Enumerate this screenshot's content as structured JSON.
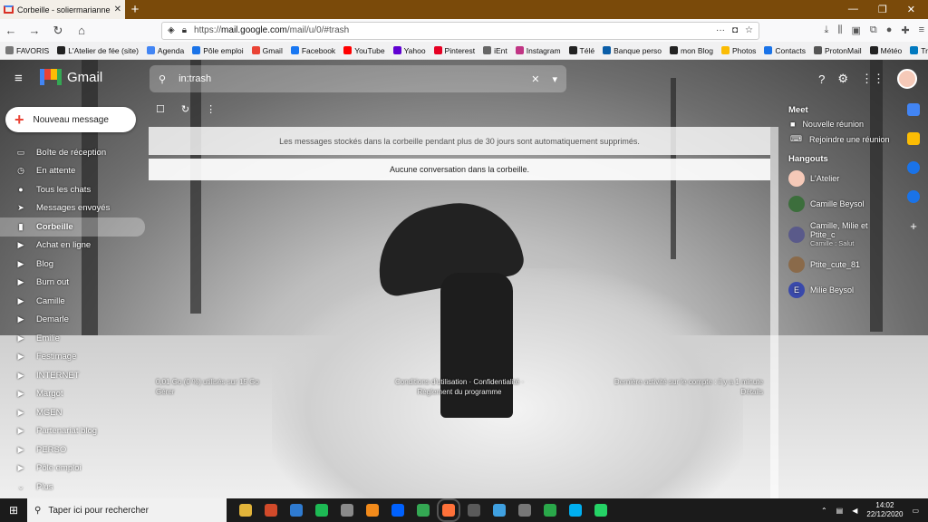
{
  "browser": {
    "tab_title": "Corbeille - soliermarianne@gm",
    "url_prefix": "https://",
    "url_domain": "mail.google.com",
    "url_path": "/mail/u/0/#trash"
  },
  "bookmarks": [
    {
      "label": "FAVORIS",
      "color": "#777"
    },
    {
      "label": "L'Atelier de fée (site)",
      "color": "#222"
    },
    {
      "label": "Agenda",
      "color": "#4285f4"
    },
    {
      "label": "Pôle emploi",
      "color": "#1a73e8"
    },
    {
      "label": "Gmail",
      "color": "#ea4335"
    },
    {
      "label": "Facebook",
      "color": "#1877f2"
    },
    {
      "label": "YouTube",
      "color": "#ff0000"
    },
    {
      "label": "Yahoo",
      "color": "#6001d2"
    },
    {
      "label": "Pinterest",
      "color": "#e60023"
    },
    {
      "label": "iEnt",
      "color": "#666"
    },
    {
      "label": "Instagram",
      "color": "#c13584"
    },
    {
      "label": "Télé",
      "color": "#222"
    },
    {
      "label": "Banque perso",
      "color": "#0b5ea8"
    },
    {
      "label": "mon Blog",
      "color": "#222"
    },
    {
      "label": "Photos",
      "color": "#fbbc04"
    },
    {
      "label": "Contacts",
      "color": "#1a73e8"
    },
    {
      "label": "ProtonMail",
      "color": "#555"
    },
    {
      "label": "Météo",
      "color": "#222"
    },
    {
      "label": "Trello",
      "color": "#0079bf"
    }
  ],
  "gmail": {
    "app_name": "Gmail",
    "search_value": "in:trash",
    "compose_label": "Nouveau message",
    "nav": [
      {
        "label": "Boîte de réception",
        "icon": "inbox-icon",
        "glyph": "▭"
      },
      {
        "label": "En attente",
        "icon": "clock-icon",
        "glyph": "◷"
      },
      {
        "label": "Tous les chats",
        "icon": "chat-icon",
        "glyph": "●"
      },
      {
        "label": "Messages envoyés",
        "icon": "send-icon",
        "glyph": "➤"
      },
      {
        "label": "Corbeille",
        "icon": "trash-icon",
        "glyph": "▮"
      },
      {
        "label": "Achat en ligne",
        "icon": "label-icon",
        "glyph": "▶"
      },
      {
        "label": "Blog",
        "icon": "label-icon",
        "glyph": "▶"
      },
      {
        "label": "Burn out",
        "icon": "label-icon",
        "glyph": "▶"
      },
      {
        "label": "Camille",
        "icon": "label-icon",
        "glyph": "▶"
      },
      {
        "label": "Demarle",
        "icon": "label-icon",
        "glyph": "▶"
      },
      {
        "label": "Emilie",
        "icon": "label-icon",
        "glyph": "▶"
      },
      {
        "label": "Festimage",
        "icon": "label-icon",
        "glyph": "▶"
      },
      {
        "label": "INTERNET",
        "icon": "label-icon",
        "glyph": "▶"
      },
      {
        "label": "Margot",
        "icon": "label-icon",
        "glyph": "▶"
      },
      {
        "label": "MGEN",
        "icon": "label-icon",
        "glyph": "▶"
      },
      {
        "label": "Partenariat blog",
        "icon": "label-icon",
        "glyph": "▶"
      },
      {
        "label": "PERSO",
        "icon": "label-icon",
        "glyph": "▶"
      },
      {
        "label": "Pôle emploi",
        "icon": "label-icon",
        "glyph": "▶"
      },
      {
        "label": "Plus",
        "icon": "chevron-down-icon",
        "glyph": "⌄"
      }
    ],
    "active_nav": "Corbeille",
    "trash_notice": "Les messages stockés dans la corbeille pendant plus de 30 jours sont automatiquement supprimés.",
    "empty_text": "Aucune conversation dans la corbeille.",
    "footer": {
      "storage": "0,01 Go (0 %) utilisés sur 15 Go",
      "manage": "Gérer",
      "terms": "Conditions d'utilisation · Confidentialité · Règlement du programme",
      "activity": "Dernière activité sur le compte : il y a 1 minute",
      "details": "Détails"
    },
    "meet": {
      "title": "Meet",
      "new_meeting": "Nouvelle réunion",
      "join_meeting": "Rejoindre une réunion"
    },
    "hangouts": {
      "title": "Hangouts",
      "contacts": [
        {
          "name": "L'Atelier",
          "sub": "",
          "color": "#f5c9b8",
          "initial": ""
        },
        {
          "name": "Camille Beysol",
          "sub": "",
          "color": "#3c6e3c",
          "initial": ""
        },
        {
          "name": "Camille, Milie et Ptite_c",
          "sub": "Camille : Salut",
          "color": "#5a5a8a",
          "initial": ""
        },
        {
          "name": "Ptite_cute_81",
          "sub": "",
          "color": "#8a6a4a",
          "initial": ""
        },
        {
          "name": "Milie Beysol",
          "sub": "",
          "color": "#3949ab",
          "initial": "E"
        }
      ]
    }
  },
  "taskbar": {
    "search_placeholder": "Taper ici pour rechercher",
    "time": "14:02",
    "date": "22/12/2020",
    "apps": [
      "#e2b43a",
      "#d24a2a",
      "#2f7bd1",
      "#1db954",
      "#8a8a8a",
      "#f38b1b",
      "#0061fe",
      "#34a853",
      "#ff7139",
      "#5a5a5a",
      "#3fa0e0",
      "#777",
      "#2aa84a",
      "#00aff0",
      "#25d366"
    ]
  }
}
